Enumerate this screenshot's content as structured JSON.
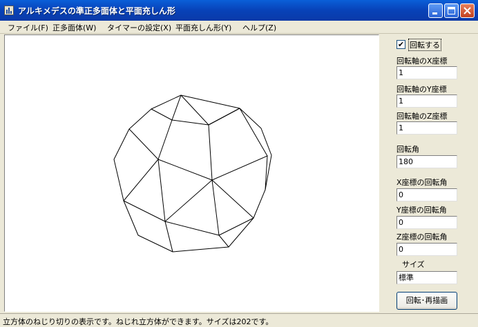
{
  "window": {
    "title": "アルキメデスの準正多面体と平面充しん形"
  },
  "menu": [
    {
      "label": "ファイル(F)"
    },
    {
      "label": "正多面体(W)"
    },
    {
      "label": "タイマーの設定(X)"
    },
    {
      "label": "平面充しん形(Y)"
    },
    {
      "label": "ヘルプ(Z)"
    }
  ],
  "panel": {
    "rotate_checkbox": {
      "label": "回転する",
      "checked": true,
      "mark": "✔"
    },
    "axis_x": {
      "label": "回転軸のX座標",
      "value": "1"
    },
    "axis_y": {
      "label": "回転軸のY座標",
      "value": "1"
    },
    "axis_z": {
      "label": "回転軸のZ座標",
      "value": "1"
    },
    "angle": {
      "label": "回転角",
      "value": "180"
    },
    "x_angle": {
      "label": "X座標の回転角",
      "value": "0"
    },
    "y_angle": {
      "label": "Y座標の回転角",
      "value": "0"
    },
    "z_angle": {
      "label": "Z座標の回転角",
      "value": "0"
    },
    "size": {
      "label": "サイズ",
      "value": "標準"
    },
    "redraw_button": {
      "label": "回転･再描画"
    }
  },
  "status": {
    "text": "立方体のねじり切りの表示です。ねじれ立方体ができます。サイズは202です。"
  },
  "colors": {
    "titlebar": "#0a5fd8",
    "close_button": "#c2401e",
    "face": "#ece9d8"
  }
}
